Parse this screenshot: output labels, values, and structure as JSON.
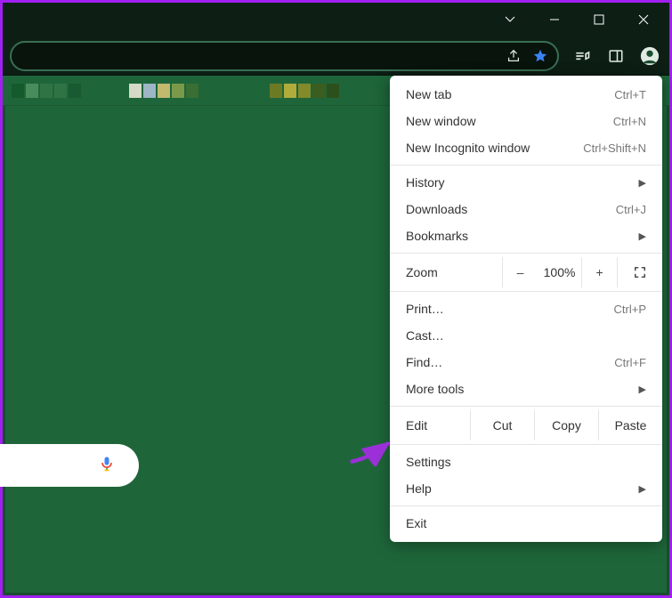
{
  "window": {
    "minimize": "–",
    "maximize": "▢",
    "close": "✕"
  },
  "menu": {
    "new_tab": {
      "label": "New tab",
      "shortcut": "Ctrl+T"
    },
    "new_window": {
      "label": "New window",
      "shortcut": "Ctrl+N"
    },
    "incognito": {
      "label": "New Incognito window",
      "shortcut": "Ctrl+Shift+N"
    },
    "history": {
      "label": "History"
    },
    "downloads": {
      "label": "Downloads",
      "shortcut": "Ctrl+J"
    },
    "bookmarks": {
      "label": "Bookmarks"
    },
    "zoom": {
      "label": "Zoom",
      "value": "100%"
    },
    "print": {
      "label": "Print…",
      "shortcut": "Ctrl+P"
    },
    "cast": {
      "label": "Cast…"
    },
    "find": {
      "label": "Find…",
      "shortcut": "Ctrl+F"
    },
    "more_tools": {
      "label": "More tools"
    },
    "edit": {
      "label": "Edit",
      "cut": "Cut",
      "copy": "Copy",
      "paste": "Paste"
    },
    "settings": {
      "label": "Settings"
    },
    "help": {
      "label": "Help"
    },
    "exit": {
      "label": "Exit"
    }
  }
}
